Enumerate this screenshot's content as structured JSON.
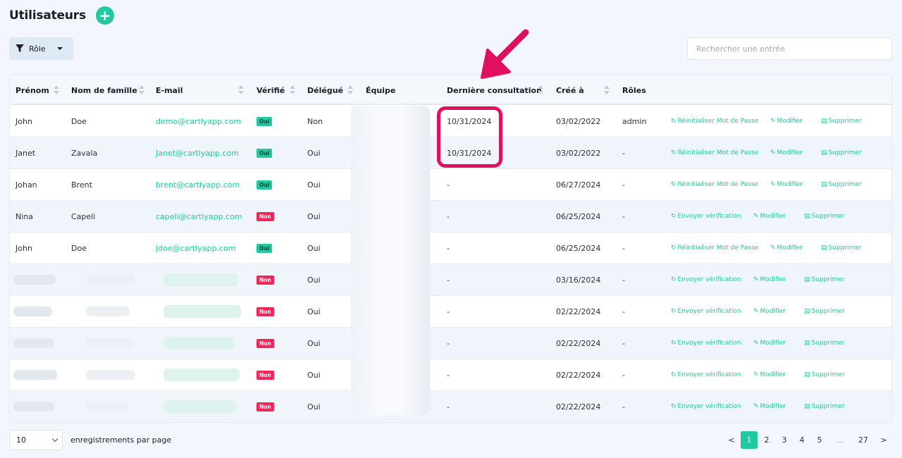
{
  "header": {
    "title": "Utilisateurs",
    "add_label": "+"
  },
  "toolbar": {
    "filter_label": "Rôle",
    "search_placeholder": "Rechercher une entrée"
  },
  "columns": {
    "first_name": "Prénom",
    "last_name": "Nom de famille",
    "email": "E-mail",
    "verified": "Vérifié",
    "delegated": "Délégué",
    "team": "Équipe",
    "last_seen": "Dernière consultation",
    "created": "Créé à",
    "roles": "Rôles"
  },
  "rows": [
    {
      "first": "John",
      "last": "Doe",
      "email": "demo@cartlyapp.com",
      "verified": "Oui",
      "delegated": "Non",
      "last_seen": "10/31/2024",
      "created": "03/02/2022",
      "roles": "admin",
      "action1": "Réinitialiser Mot de Passe",
      "action2": "Modifier",
      "action3": "Supprimer"
    },
    {
      "first": "Janet",
      "last": "Zavala",
      "email": "Janet@cartlyapp.com",
      "verified": "Oui",
      "delegated": "Oui",
      "last_seen": "10/31/2024",
      "created": "03/02/2022",
      "roles": "-",
      "action1": "Réinitialiser Mot de Passe",
      "action2": "Modifier",
      "action3": "Supprimer"
    },
    {
      "first": "Johan",
      "last": "Brent",
      "email": "brent@cartlyapp.com",
      "verified": "Oui",
      "delegated": "Oui",
      "last_seen": "-",
      "created": "06/27/2024",
      "roles": "-",
      "action1": "Réinitialiser Mot de Passe",
      "action2": "Modifier",
      "action3": "Supprimer"
    },
    {
      "first": "Nina",
      "last": "Capeli",
      "email": "capeli@cartlyapp.com",
      "verified": "Non",
      "delegated": "Oui",
      "last_seen": "-",
      "created": "06/25/2024",
      "roles": "-",
      "action1": "Envoyer vérification",
      "action2": "Modifier",
      "action3": "Supprimer"
    },
    {
      "first": "John",
      "last": "Doe",
      "email": "jdoe@cartlyapp.com",
      "verified": "Oui",
      "delegated": "Oui",
      "last_seen": "-",
      "created": "06/25/2024",
      "roles": "-",
      "action1": "Réinitialiser Mot de Passe",
      "action2": "Modifier",
      "action3": "Supprimer"
    },
    {
      "first": "",
      "last": "",
      "email": "",
      "verified": "Non",
      "delegated": "Oui",
      "last_seen": "-",
      "created": "03/16/2024",
      "roles": "-",
      "action1": "Envoyer vérification",
      "action2": "Modifier",
      "action3": "Supprimer"
    },
    {
      "first": "",
      "last": "",
      "email": "",
      "verified": "Non",
      "delegated": "Oui",
      "last_seen": "-",
      "created": "02/22/2024",
      "roles": "-",
      "action1": "Envoyer vérification",
      "action2": "Modifier",
      "action3": "Supprimer"
    },
    {
      "first": "",
      "last": "",
      "email": "",
      "verified": "Non",
      "delegated": "Oui",
      "last_seen": "-",
      "created": "02/22/2024",
      "roles": "-",
      "action1": "Envoyer vérification",
      "action2": "Modifier",
      "action3": "Supprimer"
    },
    {
      "first": "",
      "last": "",
      "email": "",
      "verified": "Non",
      "delegated": "Oui",
      "last_seen": "-",
      "created": "02/22/2024",
      "roles": "-",
      "action1": "Envoyer vérification",
      "action2": "Modifier",
      "action3": "Supprimer"
    },
    {
      "first": "",
      "last": "",
      "email": "",
      "verified": "Non",
      "delegated": "Oui",
      "last_seen": "-",
      "created": "02/22/2024",
      "roles": "-",
      "action1": "Envoyer vérification",
      "action2": "Modifier",
      "action3": "Supprimer"
    }
  ],
  "footer": {
    "page_size": "10",
    "page_size_label": "enregistrements par page",
    "pages": {
      "prev": "<",
      "p1": "1",
      "p2": "2",
      "p3": "3",
      "p4": "4",
      "p5": "5",
      "ellipsis": "...",
      "last": "27",
      "next": ">"
    }
  },
  "colors": {
    "accent": "#22c9a0",
    "danger": "#f0285a",
    "annotation": "#e0105e"
  }
}
